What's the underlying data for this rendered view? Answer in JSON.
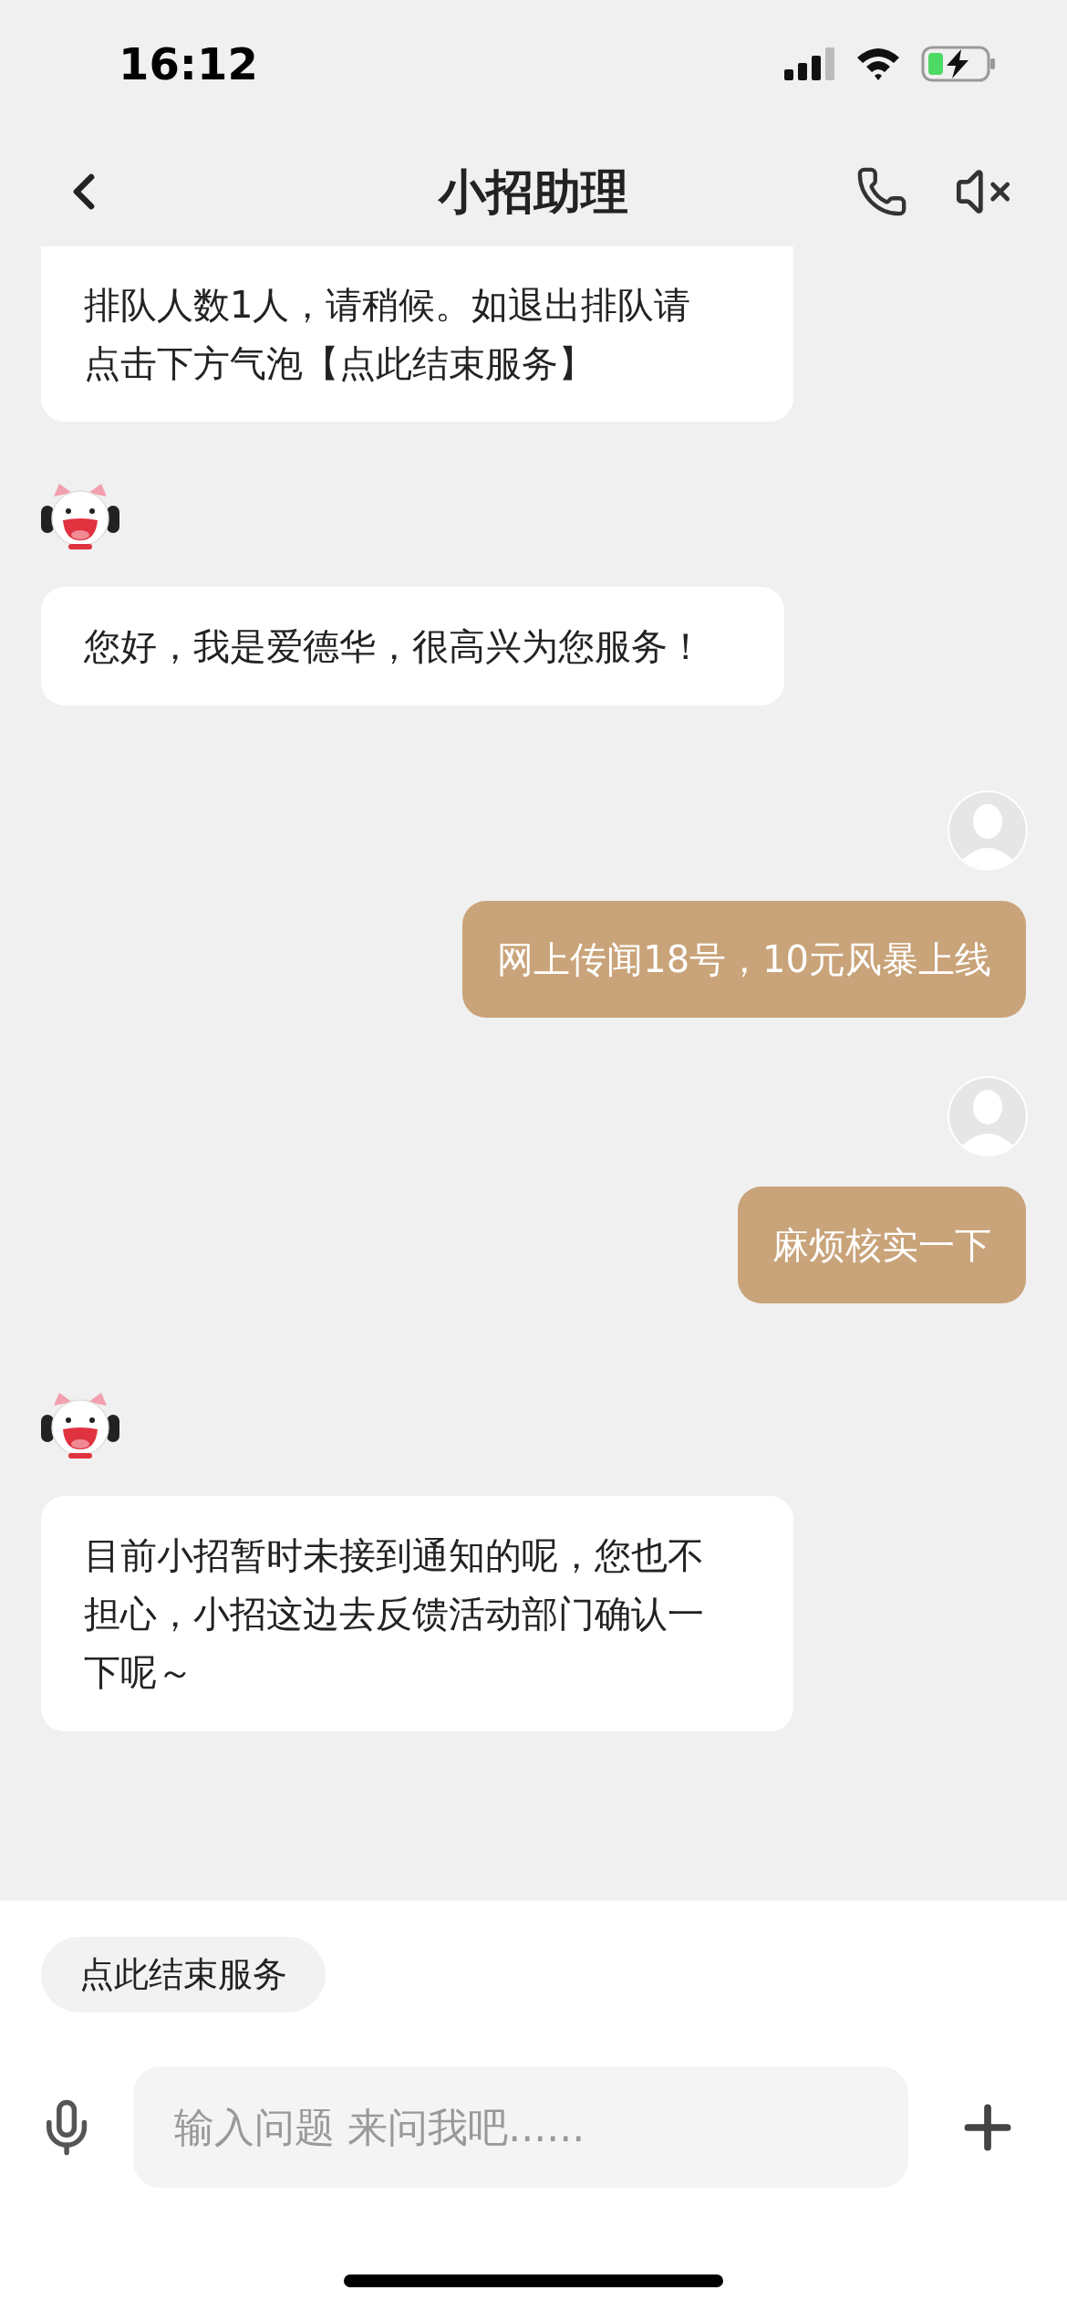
{
  "status_bar": {
    "time": "16:12"
  },
  "header": {
    "title": "小招助理"
  },
  "messages": [
    {
      "kind": "bot",
      "avatar_visible": false,
      "text": "排队人数1人，请稍候。如退出排队请点击下方气泡【点此结束服务】"
    },
    {
      "kind": "bot",
      "avatar_visible": true,
      "text": "您好，我是爱德华，很高兴为您服务！"
    },
    {
      "kind": "user",
      "avatar_visible": true,
      "text": "网上传闻18号，10元风暴上线"
    },
    {
      "kind": "user",
      "avatar_visible": true,
      "text": "麻烦核实一下"
    },
    {
      "kind": "bot",
      "avatar_visible": true,
      "text": "目前小招暂时未接到通知的呢，您也不担心，小招这边去反馈活动部门确认一下呢～"
    }
  ],
  "quick_reply": "点此结束服务",
  "input": {
    "placeholder": "输入问题 来问我吧......"
  }
}
